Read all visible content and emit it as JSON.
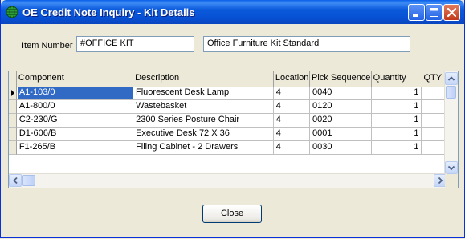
{
  "window": {
    "title": "OE Credit Note  Inquiry - Kit Details"
  },
  "icons": {
    "app": "globe-icon",
    "minimize": "minimize-icon",
    "maximize": "maximize-icon",
    "close": "close-icon"
  },
  "form": {
    "item_number_label": "Item Number",
    "item_number_value": "#OFFICE KIT",
    "item_description_value": "Office Furniture Kit Standard"
  },
  "grid": {
    "columns": [
      "Component",
      "Description",
      "Location",
      "Pick Sequence",
      "Quantity",
      "QTY"
    ],
    "rows": [
      {
        "component": "A1-103/0",
        "description": "Fluorescent Desk Lamp",
        "location": "4",
        "pick_sequence": "0040",
        "quantity": "1",
        "selected": true
      },
      {
        "component": "A1-800/0",
        "description": "Wastebasket",
        "location": "4",
        "pick_sequence": "0120",
        "quantity": "1",
        "selected": false
      },
      {
        "component": "C2-230/G",
        "description": "2300 Series Posture Chair",
        "location": "4",
        "pick_sequence": "0020",
        "quantity": "1",
        "selected": false
      },
      {
        "component": "D1-606/B",
        "description": "Executive Desk 72 X 36",
        "location": "4",
        "pick_sequence": "0001",
        "quantity": "1",
        "selected": false
      },
      {
        "component": "F1-265/B",
        "description": "Filing Cabinet - 2 Drawers",
        "location": "4",
        "pick_sequence": "0030",
        "quantity": "1",
        "selected": false
      }
    ]
  },
  "buttons": {
    "close_label": "Close"
  },
  "colors": {
    "title_bar": "#0A5FE8",
    "selection": "#316AC5",
    "background": "#ECE9D8"
  }
}
